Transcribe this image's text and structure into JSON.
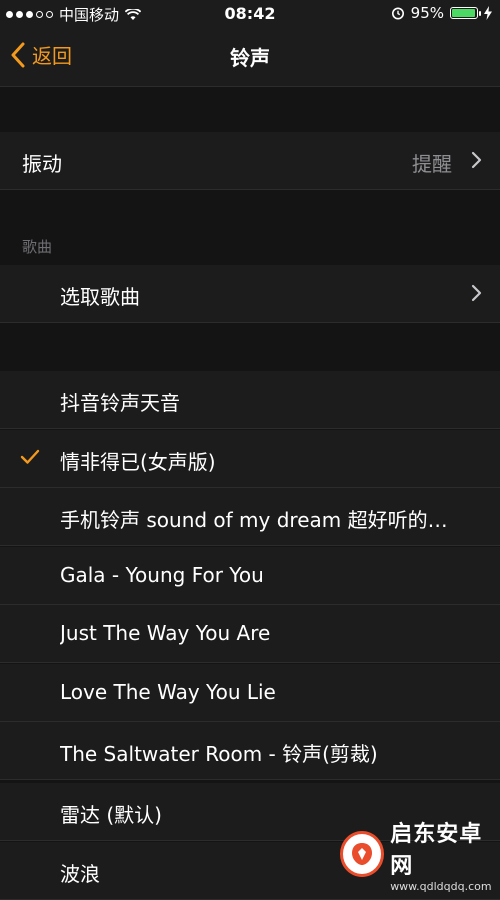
{
  "status_bar": {
    "carrier": "中国移动",
    "time": "08:42",
    "battery": "95%",
    "battery_level": 0.95
  },
  "nav": {
    "back_label": "返回",
    "title": "铃声"
  },
  "vibration": {
    "label": "振动",
    "value": "提醒"
  },
  "songs_section": {
    "header": "歌曲",
    "pick_label": "选取歌曲"
  },
  "ringtones": [
    {
      "name": "抖音铃声天音",
      "selected": false
    },
    {
      "name": "情非得已(女声版)",
      "selected": true
    },
    {
      "name": "手机铃声 sound of my dream 超好听的…",
      "selected": false
    },
    {
      "name": "Gala - Young For You",
      "selected": false
    },
    {
      "name": "Just The Way You Are",
      "selected": false
    },
    {
      "name": "Love The Way You Lie",
      "selected": false
    },
    {
      "name": "The Saltwater Room - 铃声(剪裁)",
      "selected": false
    }
  ],
  "system_tones": [
    {
      "name": "雷达 (默认)"
    },
    {
      "name": "波浪"
    }
  ],
  "watermark": {
    "title": "启东安卓网",
    "url": "www.qdldqdq.com"
  },
  "colors": {
    "accent": "#f39a1e",
    "battery_green": "#4cd964"
  }
}
